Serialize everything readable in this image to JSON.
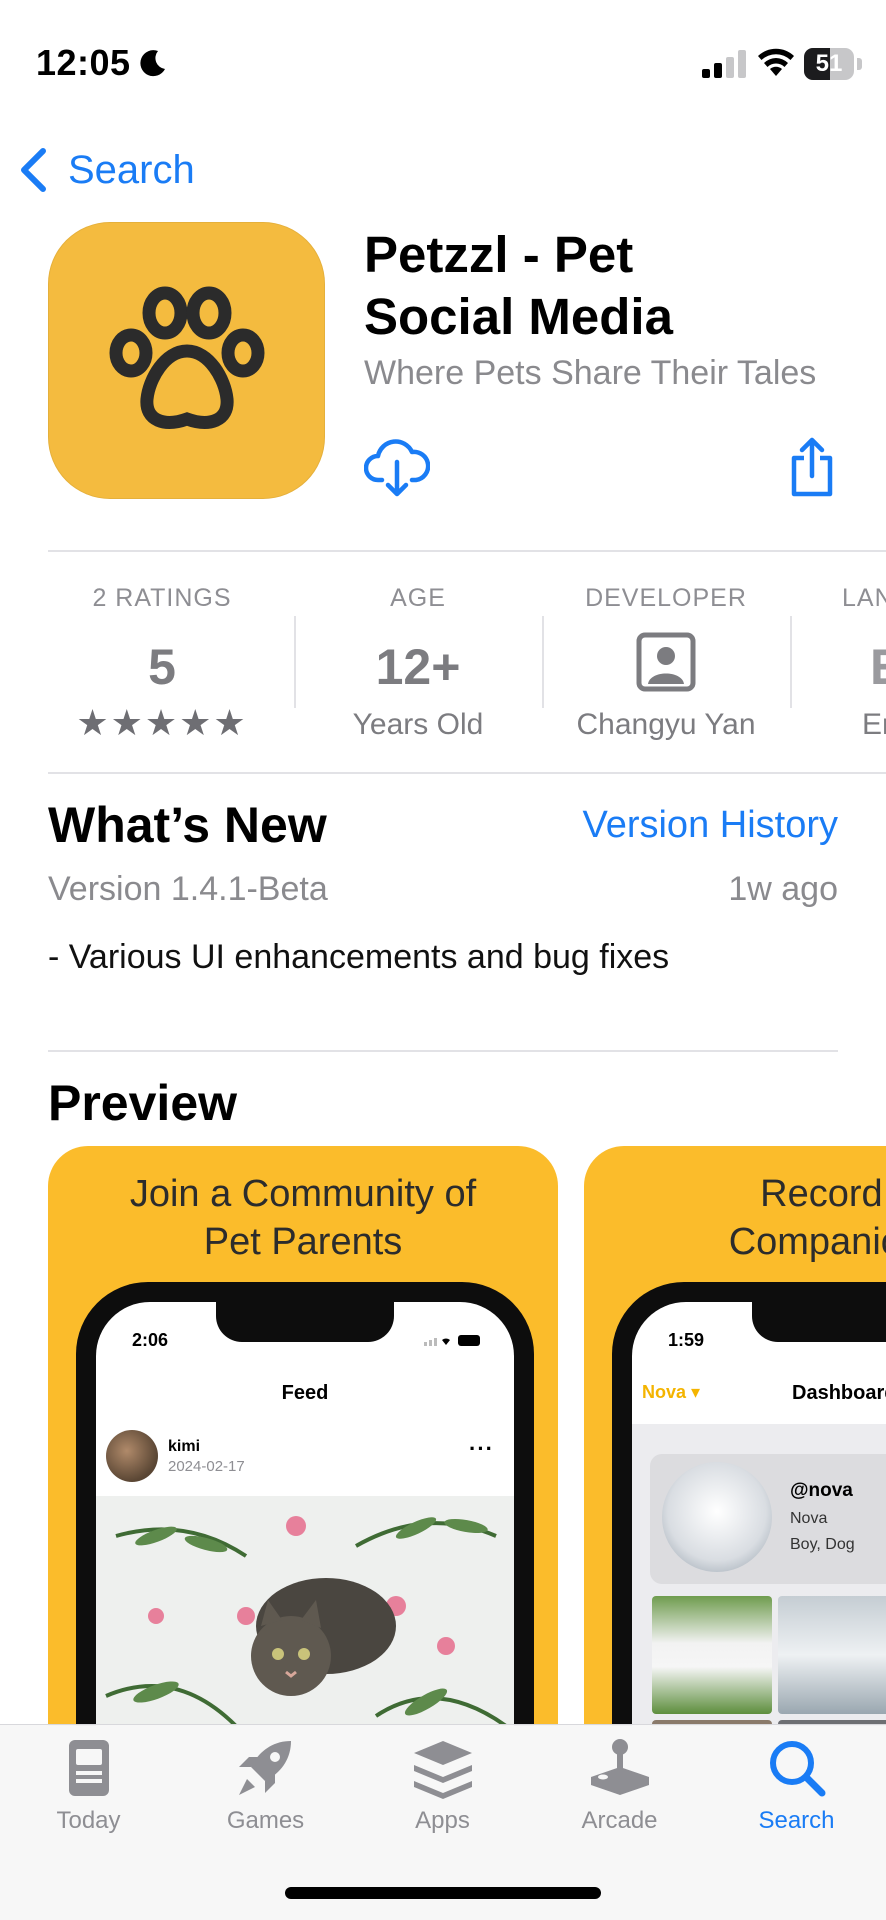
{
  "status_bar": {
    "time": "12:05",
    "battery_percent": 51,
    "battery_label": "51"
  },
  "nav": {
    "back_label": "Search"
  },
  "app": {
    "title_line1": "Petzzl - Pet",
    "title_line2": "Social Media",
    "subtitle": "Where Pets Share Their Tales",
    "icon_color": "#f4bb3f"
  },
  "info": {
    "ratings": {
      "heading": "2 RATINGS",
      "value": "5",
      "stars": "★★★★★"
    },
    "age": {
      "heading": "AGE",
      "value": "12+",
      "sub": "Years Old"
    },
    "developer": {
      "heading": "DEVELOPER",
      "sub": "Changyu Yan"
    },
    "language": {
      "heading": "LAN",
      "value": "E",
      "sub": "En"
    }
  },
  "whats_new": {
    "title": "What’s New",
    "history_link": "Version History",
    "version": "Version 1.4.1-Beta",
    "age": "1w ago",
    "notes": "- Various UI enhancements and bug fixes"
  },
  "preview": {
    "title": "Preview",
    "cards": [
      {
        "caption_line1": "Join a Community of",
        "caption_line2": "Pet Parents",
        "time": "2:06",
        "screen_title": "Feed",
        "post_user": "kimi",
        "post_date": "2024-02-17",
        "more": "···"
      },
      {
        "caption_line1": "Record Y",
        "caption_line2": "Companion's",
        "time": "1:59",
        "pet_selector": "Nova ▾",
        "screen_title": "Dashboard",
        "handle": "@nova",
        "name": "Nova",
        "desc": "Boy, Dog"
      }
    ]
  },
  "tabs": [
    {
      "label": "Today",
      "icon": "today-icon",
      "active": false
    },
    {
      "label": "Games",
      "icon": "rocket-icon",
      "active": false
    },
    {
      "label": "Apps",
      "icon": "layers-icon",
      "active": false
    },
    {
      "label": "Arcade",
      "icon": "joystick-icon",
      "active": false
    },
    {
      "label": "Search",
      "icon": "search-icon",
      "active": true
    }
  ],
  "colors": {
    "accent": "#1a7cf5",
    "card": "#fbbc2b"
  }
}
